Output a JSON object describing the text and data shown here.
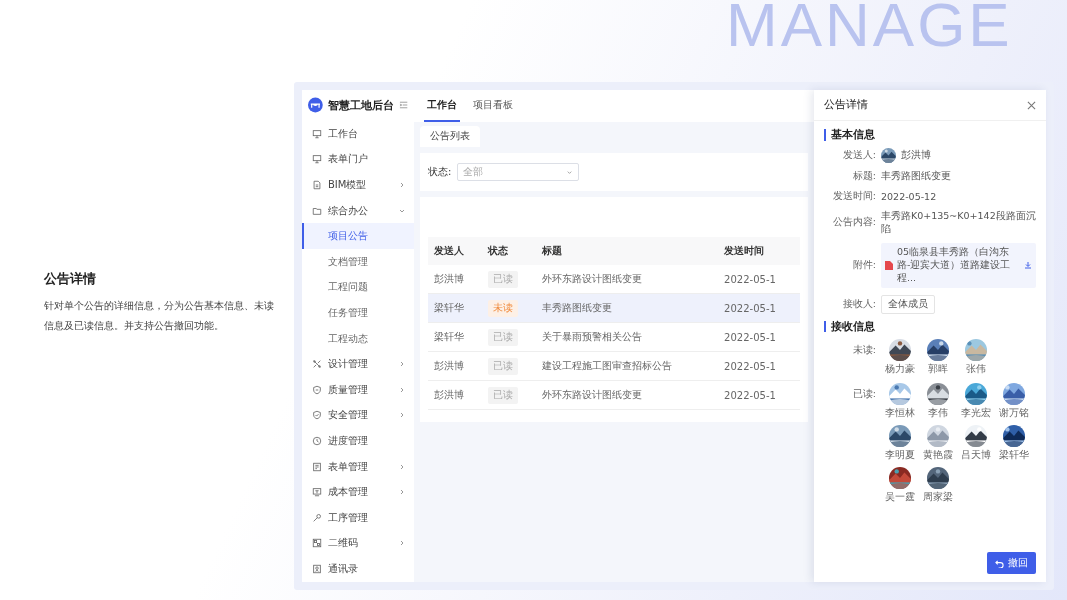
{
  "backdrop_text": "MANAGE",
  "intro": {
    "title": "公告详情",
    "body": "针对单个公告的详细信息，分为公告基本信息、未读信息及已读信息。并支持公告撤回功能。"
  },
  "app": {
    "title": "智慧工地后台",
    "tabs": [
      {
        "label": "工作台",
        "selected": true
      },
      {
        "label": "项目看板",
        "selected": false
      }
    ],
    "sidebar": {
      "items": [
        {
          "label": "工作台",
          "selected": false
        },
        {
          "label": "表单门户",
          "selected": false
        },
        {
          "label": "BIM模型",
          "selected": false,
          "expanded": false
        },
        {
          "label": "综合办公",
          "selected": false,
          "expanded": true,
          "children": [
            {
              "label": "项目公告",
              "selected": true
            },
            {
              "label": "文档管理",
              "selected": false
            },
            {
              "label": "工程问题",
              "selected": false
            },
            {
              "label": "任务管理",
              "selected": false
            },
            {
              "label": "工程动态",
              "selected": false
            }
          ]
        },
        {
          "label": "设计管理",
          "selected": false,
          "expanded": false
        },
        {
          "label": "质量管理",
          "selected": false,
          "expanded": false
        },
        {
          "label": "安全管理",
          "selected": false,
          "expanded": false
        },
        {
          "label": "进度管理",
          "selected": false
        },
        {
          "label": "表单管理",
          "selected": false,
          "expanded": false
        },
        {
          "label": "成本管理",
          "selected": false,
          "expanded": false
        },
        {
          "label": "工序管理",
          "selected": false
        },
        {
          "label": "二维码",
          "selected": false,
          "expanded": false
        },
        {
          "label": "通讯录",
          "selected": false
        }
      ]
    },
    "page_tabs": [
      {
        "label": "公告列表",
        "selected": true
      }
    ],
    "filter": {
      "label": "状态:",
      "placeholder": "全部"
    },
    "table": {
      "columns": [
        "发送人",
        "状态",
        "标题",
        "发送时间"
      ],
      "rows": [
        {
          "sender": "彭洪博",
          "status": "已读",
          "read": true,
          "title": "外环东路设计图纸变更",
          "time": "2022-05-1",
          "selected": false
        },
        {
          "sender": "梁轩华",
          "status": "未读",
          "read": false,
          "title": "丰秀路图纸变更",
          "time": "2022-05-1",
          "selected": true
        },
        {
          "sender": "梁轩华",
          "status": "已读",
          "read": true,
          "title": "关于暴雨预警相关公告",
          "time": "2022-05-1",
          "selected": false
        },
        {
          "sender": "彭洪博",
          "status": "已读",
          "read": true,
          "title": "建设工程施工图审查招标公告",
          "time": "2022-05-1",
          "selected": false
        },
        {
          "sender": "彭洪博",
          "status": "已读",
          "read": true,
          "title": "外环东路设计图纸变更",
          "time": "2022-05-1",
          "selected": false
        }
      ]
    }
  },
  "drawer": {
    "title": "公告详情",
    "basic_heading": "基本信息",
    "fields": [
      {
        "kind": "avatar",
        "label": "发送人:",
        "value": "彭洪博"
      },
      {
        "kind": "text",
        "label": "标题:",
        "value": "丰秀路图纸变更"
      },
      {
        "kind": "text",
        "label": "发送时间:",
        "value": "2022-05-12"
      },
      {
        "kind": "text",
        "label": "公告内容:",
        "value": "丰秀路K0+135~K0+142段路面沉陷"
      },
      {
        "kind": "file",
        "label": "附件:",
        "value": "05临泉县丰秀路（白沟东路-迎宾大道）道路建设工程..."
      },
      {
        "kind": "tag",
        "label": "接收人:",
        "value": "全体成员"
      }
    ],
    "receive_heading": "接收信息",
    "groups": [
      {
        "label": "未读:",
        "people": [
          {
            "name": "杨力豪"
          },
          {
            "name": "郭晖"
          },
          {
            "name": "张伟"
          }
        ]
      },
      {
        "label": "已读:",
        "people": [
          {
            "name": "李恒林"
          },
          {
            "name": "李伟"
          },
          {
            "name": "李光宏"
          },
          {
            "name": "谢万铭"
          },
          {
            "name": "李明夏"
          },
          {
            "name": "黄艳霞"
          },
          {
            "name": "吕天博"
          },
          {
            "name": "梁轩华"
          },
          {
            "name": "吴一霆"
          },
          {
            "name": "周家梁"
          }
        ]
      }
    ],
    "button": "撤回"
  }
}
